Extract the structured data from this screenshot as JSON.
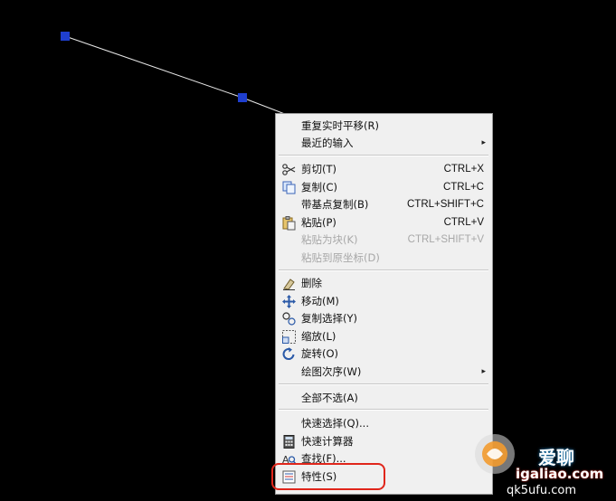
{
  "menu": {
    "items": [
      {
        "label": "重复实时平移(R)",
        "shortcut": "",
        "submenu": false,
        "disabled": false,
        "icon": ""
      },
      {
        "label": "最近的输入",
        "shortcut": "",
        "submenu": true,
        "disabled": false,
        "icon": ""
      },
      {
        "label": "剪切(T)",
        "shortcut": "CTRL+X",
        "submenu": false,
        "disabled": false,
        "icon": "scissors-icon"
      },
      {
        "label": "复制(C)",
        "shortcut": "CTRL+C",
        "submenu": false,
        "disabled": false,
        "icon": "copy-icon"
      },
      {
        "label": "带基点复制(B)",
        "shortcut": "CTRL+SHIFT+C",
        "submenu": false,
        "disabled": false,
        "icon": ""
      },
      {
        "label": "粘贴(P)",
        "shortcut": "CTRL+V",
        "submenu": false,
        "disabled": false,
        "icon": "paste-icon"
      },
      {
        "label": "粘贴为块(K)",
        "shortcut": "CTRL+SHIFT+V",
        "submenu": false,
        "disabled": true,
        "icon": ""
      },
      {
        "label": "粘贴到原坐标(D)",
        "shortcut": "",
        "submenu": false,
        "disabled": true,
        "icon": ""
      },
      {
        "label": "删除",
        "shortcut": "",
        "submenu": false,
        "disabled": false,
        "icon": "eraser-icon"
      },
      {
        "label": "移动(M)",
        "shortcut": "",
        "submenu": false,
        "disabled": false,
        "icon": "move-icon"
      },
      {
        "label": "复制选择(Y)",
        "shortcut": "",
        "submenu": false,
        "disabled": false,
        "icon": "copy-selection-icon"
      },
      {
        "label": "缩放(L)",
        "shortcut": "",
        "submenu": false,
        "disabled": false,
        "icon": "scale-icon"
      },
      {
        "label": "旋转(O)",
        "shortcut": "",
        "submenu": false,
        "disabled": false,
        "icon": "rotate-icon"
      },
      {
        "label": "绘图次序(W)",
        "shortcut": "",
        "submenu": true,
        "disabled": false,
        "icon": ""
      },
      {
        "label": "全部不选(A)",
        "shortcut": "",
        "submenu": false,
        "disabled": false,
        "icon": ""
      },
      {
        "label": "快速选择(Q)...",
        "shortcut": "",
        "submenu": false,
        "disabled": false,
        "icon": ""
      },
      {
        "label": "快速计算器",
        "shortcut": "",
        "submenu": false,
        "disabled": false,
        "icon": "calculator-icon"
      },
      {
        "label": "查找(F)...",
        "shortcut": "",
        "submenu": false,
        "disabled": false,
        "icon": "find-icon"
      },
      {
        "label": "特性(S)",
        "shortcut": "",
        "submenu": false,
        "disabled": false,
        "icon": "properties-icon"
      }
    ],
    "submenu_arrow": "▸"
  },
  "watermark": {
    "site": "igaliao.com",
    "brand": "爱聊",
    "small_text": "qk5ufu.com"
  },
  "colors": {
    "canvas_bg": "#000000",
    "line": "#e8e8e8",
    "grip": "#1f3fcf",
    "highlight_ring": "#e0261b"
  }
}
